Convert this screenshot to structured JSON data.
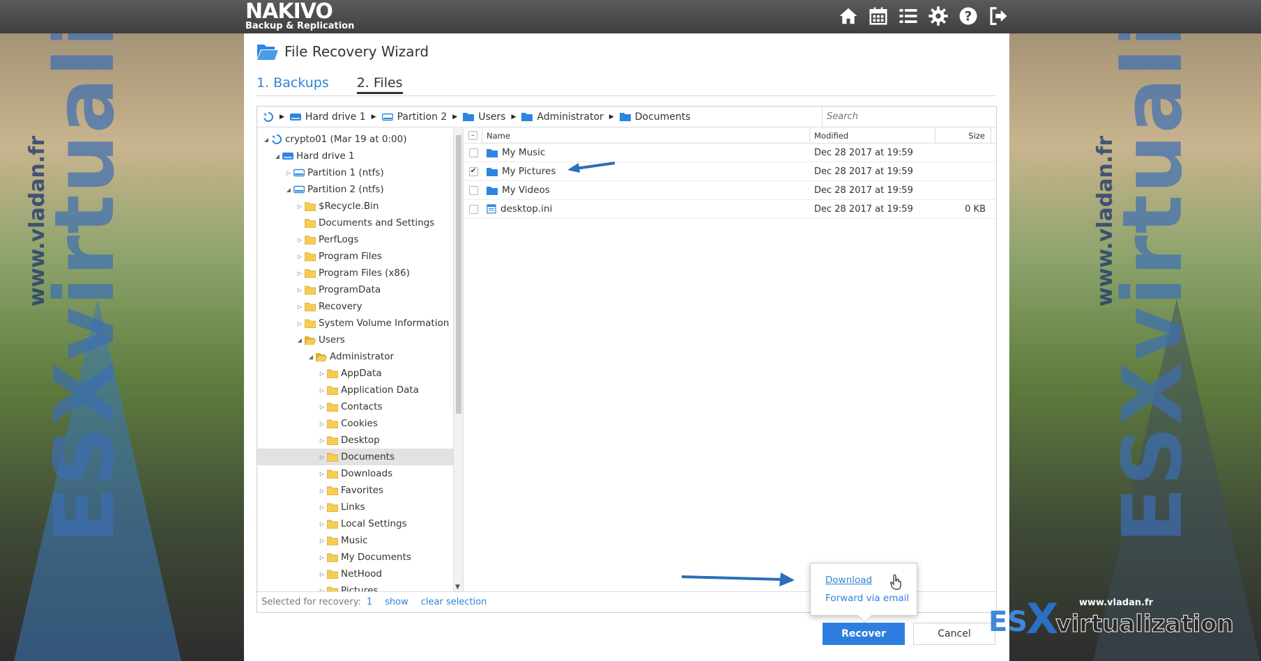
{
  "app": {
    "logo": "NAKIVO",
    "logo_sub": "Backup & Replication",
    "top_icons": [
      "home-icon",
      "calendar-icon",
      "list-icon",
      "gear-icon",
      "help-icon",
      "logout-icon"
    ]
  },
  "wizard": {
    "title": "File Recovery Wizard",
    "steps": [
      "1. Backups",
      "2. Files"
    ]
  },
  "breadcrumb": [
    "Hard drive 1",
    "Partition 2",
    "Users",
    "Administrator",
    "Documents"
  ],
  "search": {
    "placeholder": "Search"
  },
  "tree": [
    {
      "label": "crypto01 (Mar 19 at 0:00)",
      "toggle": "open"
    },
    {
      "label": "Hard drive 1",
      "toggle": "open"
    },
    {
      "label": "Partition 1 (ntfs)",
      "toggle": "closed"
    },
    {
      "label": "Partition 2 (ntfs)",
      "toggle": "open"
    },
    {
      "label": "$Recycle.Bin",
      "toggle": "closed"
    },
    {
      "label": "Documents and Settings",
      "toggle": "none"
    },
    {
      "label": "PerfLogs",
      "toggle": "closed"
    },
    {
      "label": "Program Files",
      "toggle": "closed"
    },
    {
      "label": "Program Files (x86)",
      "toggle": "closed"
    },
    {
      "label": "ProgramData",
      "toggle": "closed"
    },
    {
      "label": "Recovery",
      "toggle": "closed"
    },
    {
      "label": "System Volume Information",
      "toggle": "closed"
    },
    {
      "label": "Users",
      "toggle": "open"
    },
    {
      "label": "Administrator",
      "toggle": "open"
    },
    {
      "label": "AppData",
      "toggle": "closed"
    },
    {
      "label": "Application Data",
      "toggle": "closed"
    },
    {
      "label": "Contacts",
      "toggle": "closed"
    },
    {
      "label": "Cookies",
      "toggle": "closed"
    },
    {
      "label": "Desktop",
      "toggle": "closed"
    },
    {
      "label": "Documents",
      "toggle": "closed"
    },
    {
      "label": "Downloads",
      "toggle": "closed"
    },
    {
      "label": "Favorites",
      "toggle": "closed"
    },
    {
      "label": "Links",
      "toggle": "closed"
    },
    {
      "label": "Local Settings",
      "toggle": "closed"
    },
    {
      "label": "Music",
      "toggle": "closed"
    },
    {
      "label": "My Documents",
      "toggle": "closed"
    },
    {
      "label": "NetHood",
      "toggle": "closed"
    },
    {
      "label": "Pictures",
      "toggle": "closed"
    }
  ],
  "list": {
    "columns": {
      "name": "Name",
      "modified": "Modified",
      "size": "Size"
    },
    "rows": [
      {
        "name": "My Music",
        "modified": "Dec 28 2017 at 19:59",
        "size": "",
        "checked": false,
        "type": "folder"
      },
      {
        "name": "My Pictures",
        "modified": "Dec 28 2017 at 19:59",
        "size": "",
        "checked": true,
        "type": "folder"
      },
      {
        "name": "My Videos",
        "modified": "Dec 28 2017 at 19:59",
        "size": "",
        "checked": false,
        "type": "folder"
      },
      {
        "name": "desktop.ini",
        "modified": "Dec 28 2017 at 19:59",
        "size": "0 KB",
        "checked": false,
        "type": "file"
      }
    ]
  },
  "footer": {
    "selected_label": "Selected for recovery:",
    "selected_count": "1",
    "show_label": "show",
    "clear_label": "clear selection"
  },
  "popup": {
    "download": "Download",
    "forward": "Forward via email"
  },
  "buttons": {
    "recover": "Recover",
    "cancel": "Cancel"
  },
  "watermark": {
    "url": "www.vladan.fr",
    "brand_es": "ES",
    "brand_x": "X",
    "brand_virt": "virtualization",
    "big": "ESXvirtualization"
  },
  "colors": {
    "accent": "#2f84d6",
    "folder_blue": "#2b86e0",
    "folder_yellow": "#f2c542",
    "topbar": "#4a4a4a"
  }
}
